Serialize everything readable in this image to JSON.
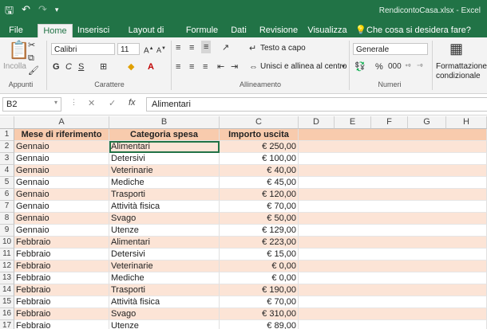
{
  "app": {
    "title": "RendicontoCasa.xlsx - Excel"
  },
  "tabs": [
    "File",
    "Home",
    "Inserisci",
    "Layout di pagina",
    "Formule",
    "Dati",
    "Revisione",
    "Visualizza"
  ],
  "tell_me": "Che cosa si desidera fare?",
  "ribbon": {
    "paste_label": "Incolla",
    "font_name": "Calibri",
    "font_size": "11",
    "wrap_text": "Testo a capo",
    "merge_center": "Unisci e allinea al centro",
    "number_format": "Generale",
    "cond_format_1": "Formattazione",
    "cond_format_2": "condizionale",
    "group_clipboard": "Appunti",
    "group_font": "Carattere",
    "group_alignment": "Allineamento",
    "group_number": "Numeri"
  },
  "formula_bar": {
    "name_box": "B2",
    "formula": "Alimentari"
  },
  "sheet": {
    "columns": [
      "A",
      "B",
      "C",
      "D",
      "E",
      "F",
      "G",
      "H"
    ],
    "header": [
      "Mese di riferimento",
      "Categoria spesa",
      "Importo uscita"
    ],
    "rows": [
      {
        "n": "2",
        "a": "Gennaio",
        "b": "Alimentari",
        "c": "€ 250,00"
      },
      {
        "n": "3",
        "a": "Gennaio",
        "b": "Detersivi",
        "c": "€ 100,00"
      },
      {
        "n": "4",
        "a": "Gennaio",
        "b": "Veterinarie",
        "c": "€ 40,00"
      },
      {
        "n": "5",
        "a": "Gennaio",
        "b": "Mediche",
        "c": "€ 45,00"
      },
      {
        "n": "6",
        "a": "Gennaio",
        "b": "Trasporti",
        "c": "€ 120,00"
      },
      {
        "n": "7",
        "a": "Gennaio",
        "b": "Attività fisica",
        "c": "€ 70,00"
      },
      {
        "n": "8",
        "a": "Gennaio",
        "b": "Svago",
        "c": "€ 50,00"
      },
      {
        "n": "9",
        "a": "Gennaio",
        "b": "Utenze",
        "c": "€ 129,00"
      },
      {
        "n": "10",
        "a": "Febbraio",
        "b": "Alimentari",
        "c": "€ 223,00"
      },
      {
        "n": "11",
        "a": "Febbraio",
        "b": "Detersivi",
        "c": "€ 15,00"
      },
      {
        "n": "12",
        "a": "Febbraio",
        "b": "Veterinarie",
        "c": "€ 0,00"
      },
      {
        "n": "13",
        "a": "Febbraio",
        "b": "Mediche",
        "c": "€ 0,00"
      },
      {
        "n": "14",
        "a": "Febbraio",
        "b": "Trasporti",
        "c": "€ 190,00"
      },
      {
        "n": "15",
        "a": "Febbraio",
        "b": "Attività fisica",
        "c": "€ 70,00"
      },
      {
        "n": "16",
        "a": "Febbraio",
        "b": "Svago",
        "c": "€ 310,00"
      },
      {
        "n": "17",
        "a": "Febbraio",
        "b": "Utenze",
        "c": "€ 89,00"
      }
    ]
  },
  "colors": {
    "accent": "#217346",
    "header_fill": "#f8cbad",
    "band_fill": "#fce4d6"
  }
}
